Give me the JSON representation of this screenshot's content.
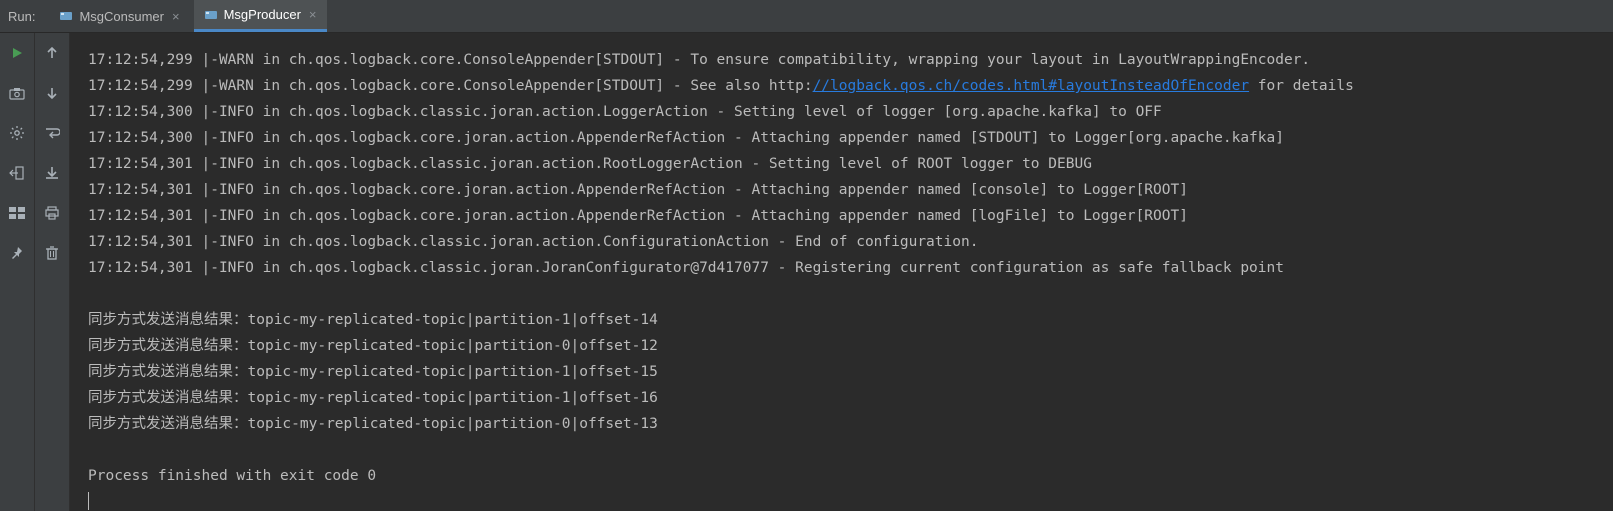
{
  "runBar": {
    "label": "Run:",
    "tabs": [
      {
        "icon": "consumer",
        "label": "MsgConsumer",
        "active": false
      },
      {
        "icon": "producer",
        "label": "MsgProducer",
        "active": true
      }
    ]
  },
  "toolbars": {
    "col1": [
      "run",
      "up",
      "down",
      "camera",
      "cog",
      "export-left",
      "layout",
      "pin"
    ],
    "col2": [
      "spacer",
      "arrow-up",
      "arrow-down",
      "wrap",
      "scroll-end",
      "print",
      "trash"
    ]
  },
  "console": {
    "lines": [
      {
        "type": "log",
        "text": "17:12:54,299 |-WARN in ch.qos.logback.core.ConsoleAppender[STDOUT] - To ensure compatibility, wrapping your layout in LayoutWrappingEncoder."
      },
      {
        "type": "loglink",
        "prefix": "17:12:54,299 |-WARN in ch.qos.logback.core.ConsoleAppender[STDOUT] - See also http:",
        "link": "//logback.qos.ch/codes.html#layoutInsteadOfEncoder",
        "suffix": " for details"
      },
      {
        "type": "log",
        "text": "17:12:54,300 |-INFO in ch.qos.logback.classic.joran.action.LoggerAction - Setting level of logger [org.apache.kafka] to OFF"
      },
      {
        "type": "log",
        "text": "17:12:54,300 |-INFO in ch.qos.logback.core.joran.action.AppenderRefAction - Attaching appender named [STDOUT] to Logger[org.apache.kafka]"
      },
      {
        "type": "log",
        "text": "17:12:54,301 |-INFO in ch.qos.logback.classic.joran.action.RootLoggerAction - Setting level of ROOT logger to DEBUG"
      },
      {
        "type": "log",
        "text": "17:12:54,301 |-INFO in ch.qos.logback.core.joran.action.AppenderRefAction - Attaching appender named [console] to Logger[ROOT]"
      },
      {
        "type": "log",
        "text": "17:12:54,301 |-INFO in ch.qos.logback.core.joran.action.AppenderRefAction - Attaching appender named [logFile] to Logger[ROOT]"
      },
      {
        "type": "log",
        "text": "17:12:54,301 |-INFO in ch.qos.logback.classic.joran.action.ConfigurationAction - End of configuration."
      },
      {
        "type": "log",
        "text": "17:12:54,301 |-INFO in ch.qos.logback.classic.joran.JoranConfigurator@7d417077 - Registering current configuration as safe fallback point"
      },
      {
        "type": "blank"
      },
      {
        "type": "log",
        "text": "同步方式发送消息结果：topic-my-replicated-topic|partition-1|offset-14"
      },
      {
        "type": "log",
        "text": "同步方式发送消息结果：topic-my-replicated-topic|partition-0|offset-12"
      },
      {
        "type": "log",
        "text": "同步方式发送消息结果：topic-my-replicated-topic|partition-1|offset-15"
      },
      {
        "type": "log",
        "text": "同步方式发送消息结果：topic-my-replicated-topic|partition-1|offset-16"
      },
      {
        "type": "log",
        "text": "同步方式发送消息结果：topic-my-replicated-topic|partition-0|offset-13"
      },
      {
        "type": "blank"
      },
      {
        "type": "log",
        "text": "Process finished with exit code 0"
      }
    ]
  }
}
